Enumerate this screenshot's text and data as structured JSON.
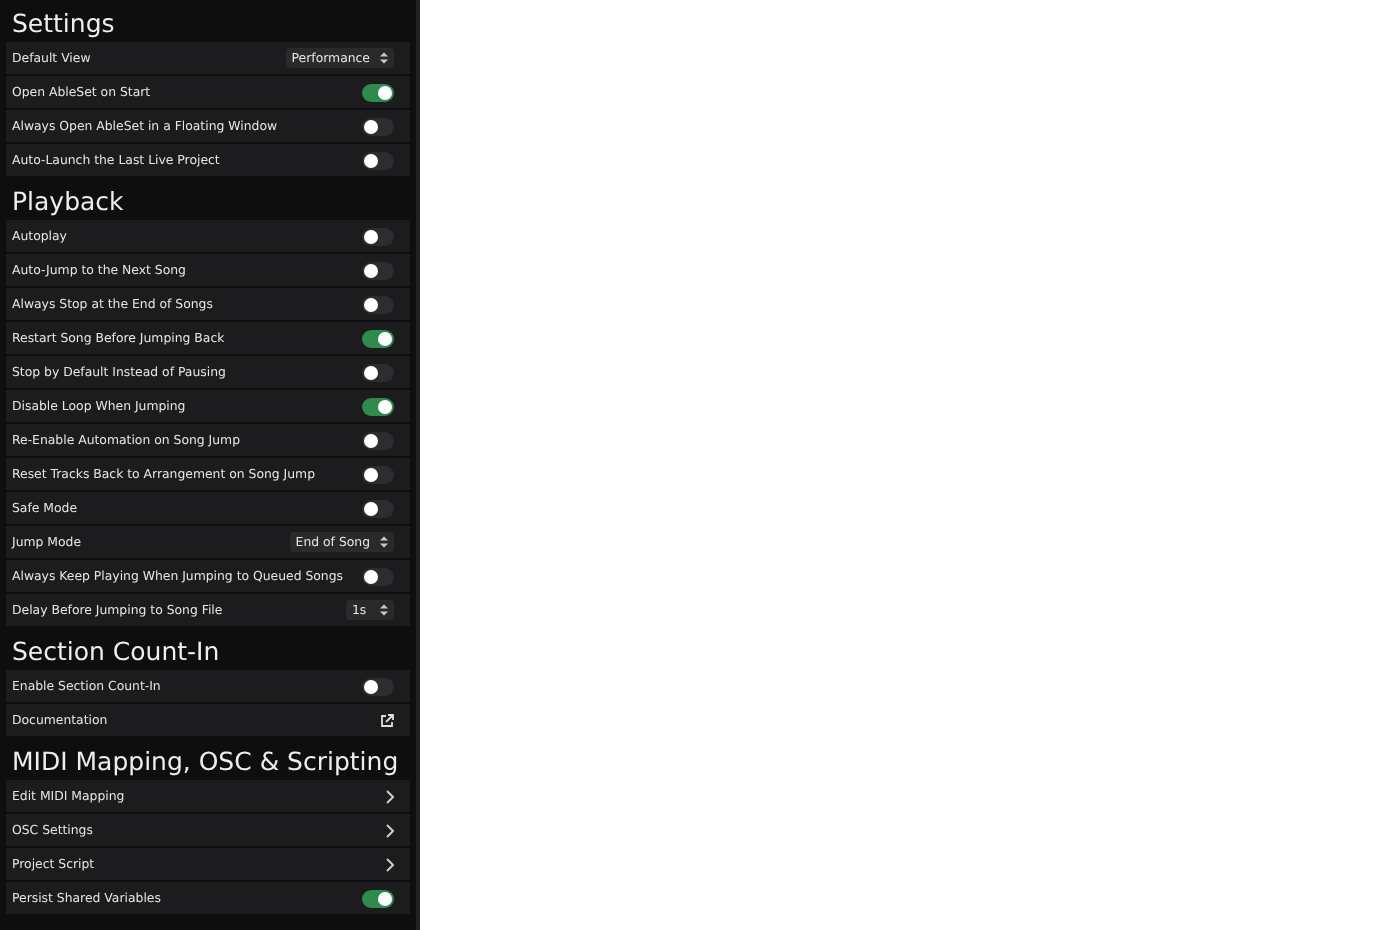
{
  "sections": [
    {
      "title": "Settings",
      "rows": [
        {
          "kind": "select",
          "label": "Default View",
          "value": "Performance"
        },
        {
          "kind": "toggle",
          "label": "Open AbleSet on Start",
          "on": true
        },
        {
          "kind": "toggle",
          "label": "Always Open AbleSet in a Floating Window",
          "on": false
        },
        {
          "kind": "toggle",
          "label": "Auto-Launch the Last Live Project",
          "on": false
        }
      ]
    },
    {
      "title": "Playback",
      "rows": [
        {
          "kind": "toggle",
          "label": "Autoplay",
          "on": false
        },
        {
          "kind": "toggle",
          "label": "Auto-Jump to the Next Song",
          "on": false
        },
        {
          "kind": "toggle",
          "label": "Always Stop at the End of Songs",
          "on": false
        },
        {
          "kind": "toggle",
          "label": "Restart Song Before Jumping Back",
          "on": true
        },
        {
          "kind": "toggle",
          "label": "Stop by Default Instead of Pausing",
          "on": false
        },
        {
          "kind": "toggle",
          "label": "Disable Loop When Jumping",
          "on": true
        },
        {
          "kind": "toggle",
          "label": "Re-Enable Automation on Song Jump",
          "on": false
        },
        {
          "kind": "toggle",
          "label": "Reset Tracks Back to Arrangement on Song Jump",
          "on": false
        },
        {
          "kind": "toggle",
          "label": "Safe Mode",
          "on": false
        },
        {
          "kind": "select",
          "label": "Jump Mode",
          "value": "End of Song"
        },
        {
          "kind": "toggle",
          "label": "Always Keep Playing When Jumping to Queued Songs",
          "on": false
        },
        {
          "kind": "select",
          "label": "Delay Before Jumping to Song File",
          "value": "1s"
        }
      ]
    },
    {
      "title": "Section Count-In",
      "rows": [
        {
          "kind": "toggle",
          "label": "Enable Section Count-In",
          "on": false
        },
        {
          "kind": "external",
          "label": "Documentation"
        }
      ]
    },
    {
      "title": "MIDI Mapping, OSC & Scripting",
      "rows": [
        {
          "kind": "nav",
          "label": "Edit MIDI Mapping"
        },
        {
          "kind": "nav",
          "label": "OSC Settings"
        },
        {
          "kind": "nav",
          "label": "Project Script"
        },
        {
          "kind": "toggle",
          "label": "Persist Shared Variables",
          "on": true
        }
      ]
    }
  ]
}
